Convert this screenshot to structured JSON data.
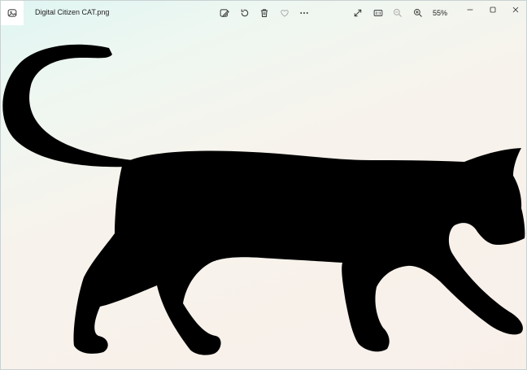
{
  "window": {
    "file_name": "Digital Citizen CAT.png",
    "zoom_level": "55%"
  },
  "toolbar": {
    "icons": [
      "edit-image-icon",
      "rotate-icon",
      "delete-icon",
      "favorite-icon",
      "more-icon"
    ],
    "view_icons": [
      "full-screen-icon",
      "actual-size-icon",
      "zoom-out-icon",
      "zoom-in-icon"
    ]
  },
  "window_controls": [
    "minimize-icon",
    "maximize-icon",
    "close-icon"
  ],
  "colors": {
    "background_top": "#dff5f2",
    "background_bottom": "#f8efe9",
    "silhouette": "#000000",
    "icon": "#333333",
    "icon_disabled": "#a6a6a6"
  }
}
